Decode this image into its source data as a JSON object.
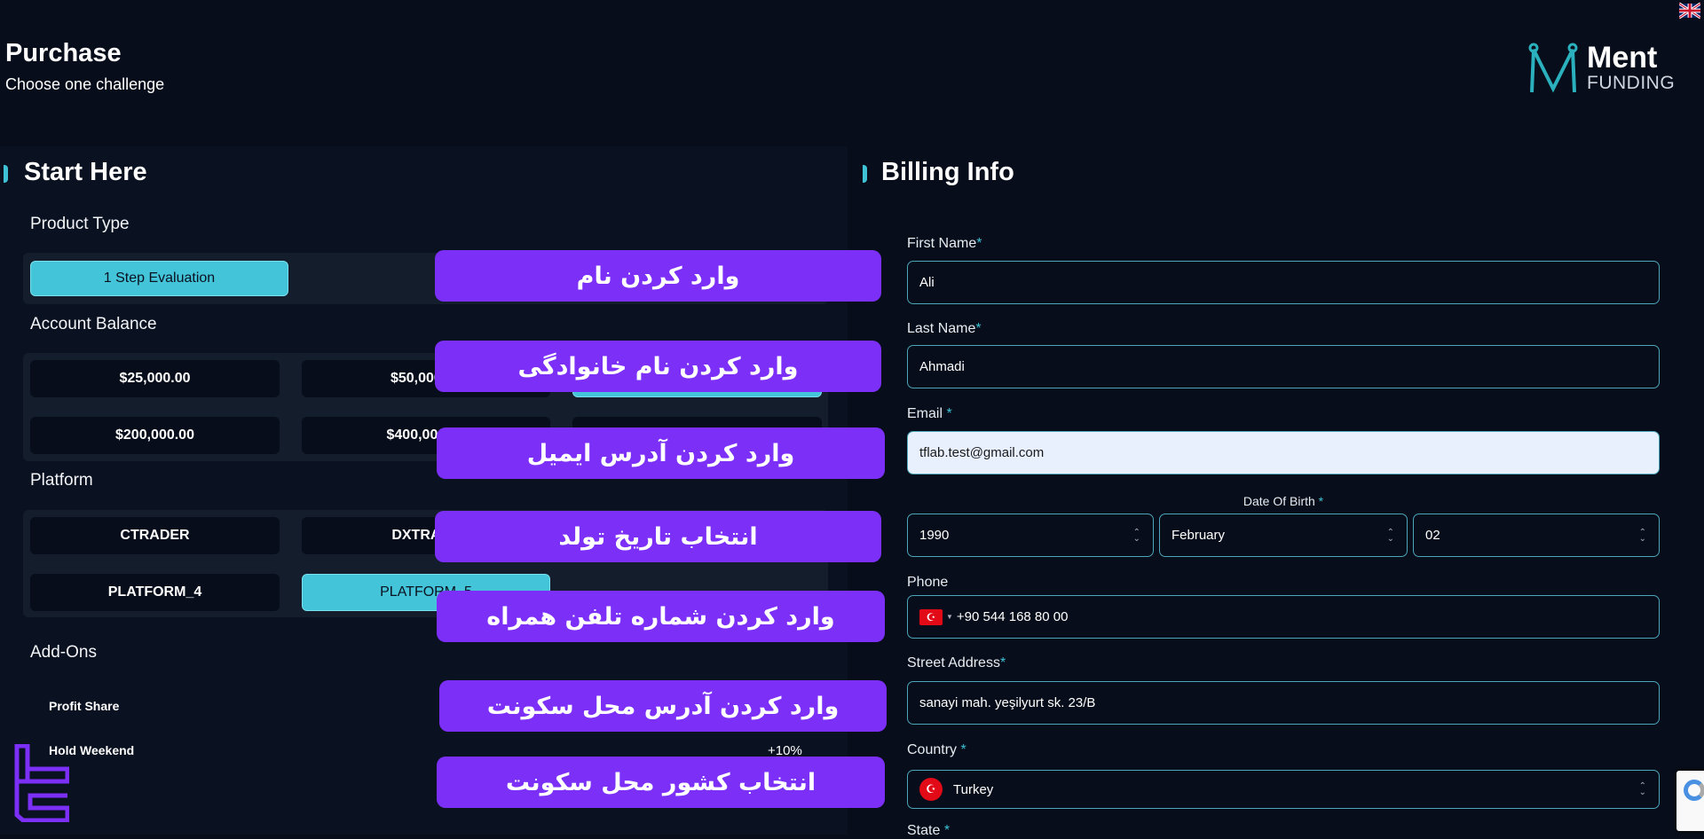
{
  "header": {
    "title": "Purchase",
    "subtitle": "Choose one challenge",
    "logo_text": "Ment",
    "logo_subtext": "FUNDING",
    "language_flag": "uk-flag-icon"
  },
  "start": {
    "title": "Start Here",
    "product_type": {
      "label": "Product Type",
      "options": [
        "1 Step Evaluation"
      ],
      "selected": "1 Step Evaluation"
    },
    "account_balance": {
      "label": "Account Balance",
      "options": [
        "$25,000.00",
        "$50,000.00",
        "",
        "$200,000.00",
        "$400,000.00",
        ""
      ],
      "selected_index": 2
    },
    "platform": {
      "label": "Platform",
      "options": [
        "CTRADER",
        "DXTRADE",
        "",
        "PLATFORM_4",
        "PLATFORM_5"
      ],
      "selected": "PLATFORM_5"
    },
    "addons": {
      "label": "Add-Ons",
      "items": [
        {
          "name": "Profit Share",
          "value": ""
        },
        {
          "name": "Hold Weekend",
          "value": "+10%"
        }
      ]
    }
  },
  "overlays": [
    "وارد کردن نام",
    "وارد کردن نام خانوادگی",
    "وارد کردن آدرس ایمیل",
    "انتخاب تاریخ تولد",
    "وارد کردن شماره تلفن همراه",
    "وارد کردن آدرس محل سکونت",
    "انتخاب کشور محل سکونت"
  ],
  "billing": {
    "title": "Billing Info",
    "first_name": {
      "label": "First Name",
      "value": "Ali"
    },
    "last_name": {
      "label": "Last Name",
      "value": "Ahmadi"
    },
    "email": {
      "label": "Email ",
      "value": "tflab.test@gmail.com"
    },
    "dob": {
      "label": "Date Of Birth ",
      "year": "1990",
      "month": "February",
      "day": "02"
    },
    "phone": {
      "label": "Phone",
      "value": "+90 544 168 80 00"
    },
    "street": {
      "label": "Street Address",
      "value": "sanayi mah. yeşilyurt sk. 23/B"
    },
    "country": {
      "label": "Country ",
      "value": "Turkey"
    },
    "state": {
      "label": "State "
    },
    "required_mark": "*"
  },
  "colors": {
    "accent": "#44c4d8",
    "overlay": "#7b2ff7",
    "background": "#070d1a"
  }
}
